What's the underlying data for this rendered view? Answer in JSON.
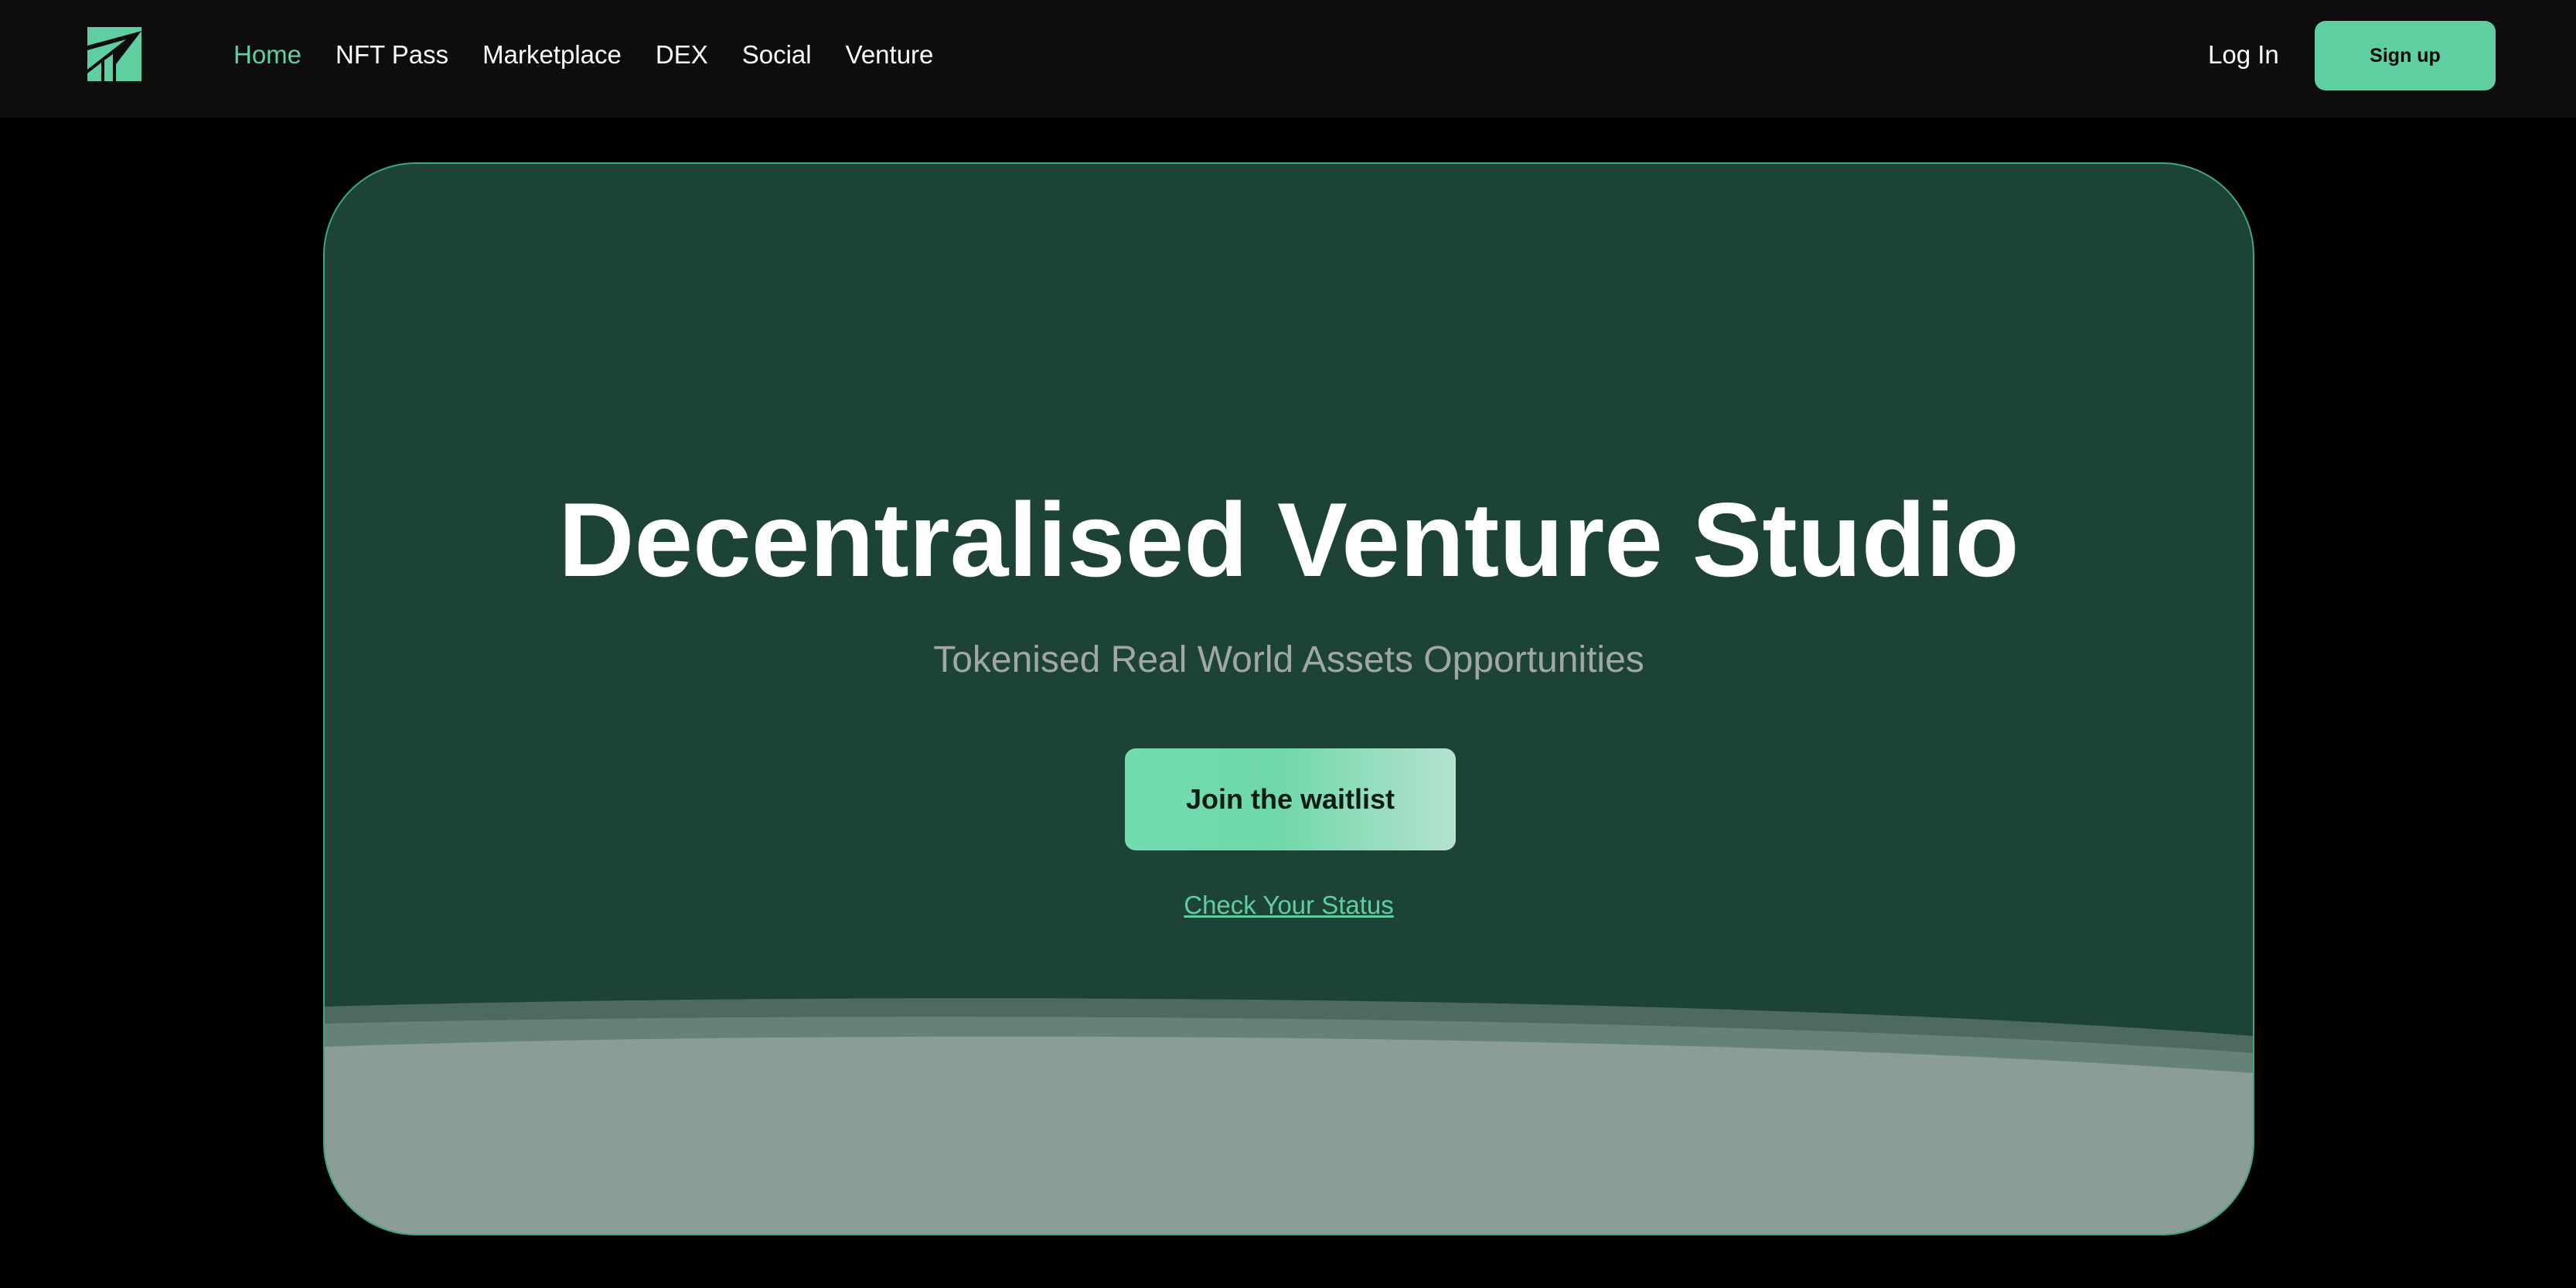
{
  "nav": {
    "logo_icon": "chart-growth-logo-icon",
    "links": [
      {
        "label": "Home",
        "active": true
      },
      {
        "label": "NFT Pass",
        "active": false
      },
      {
        "label": "Marketplace",
        "active": false
      },
      {
        "label": "DEX",
        "active": false
      },
      {
        "label": "Social",
        "active": false
      },
      {
        "label": "Venture",
        "active": false
      }
    ],
    "login_label": "Log In",
    "signup_label": "Sign up"
  },
  "hero": {
    "title": "Decentralised Venture Studio",
    "subtitle": "Tokenised Real World Assets Opportunities",
    "cta_label": "Join the waitlist",
    "status_link_label": "Check Your Status"
  },
  "colors": {
    "page_background": "#000000",
    "navbar_background": "#0d0d0d",
    "accent": "#5fcfa2",
    "hero_background": "#1c4335",
    "hero_border": "#3ea878",
    "subtitle_text": "#a1a8a4",
    "wave_light": "#8a9e97"
  }
}
